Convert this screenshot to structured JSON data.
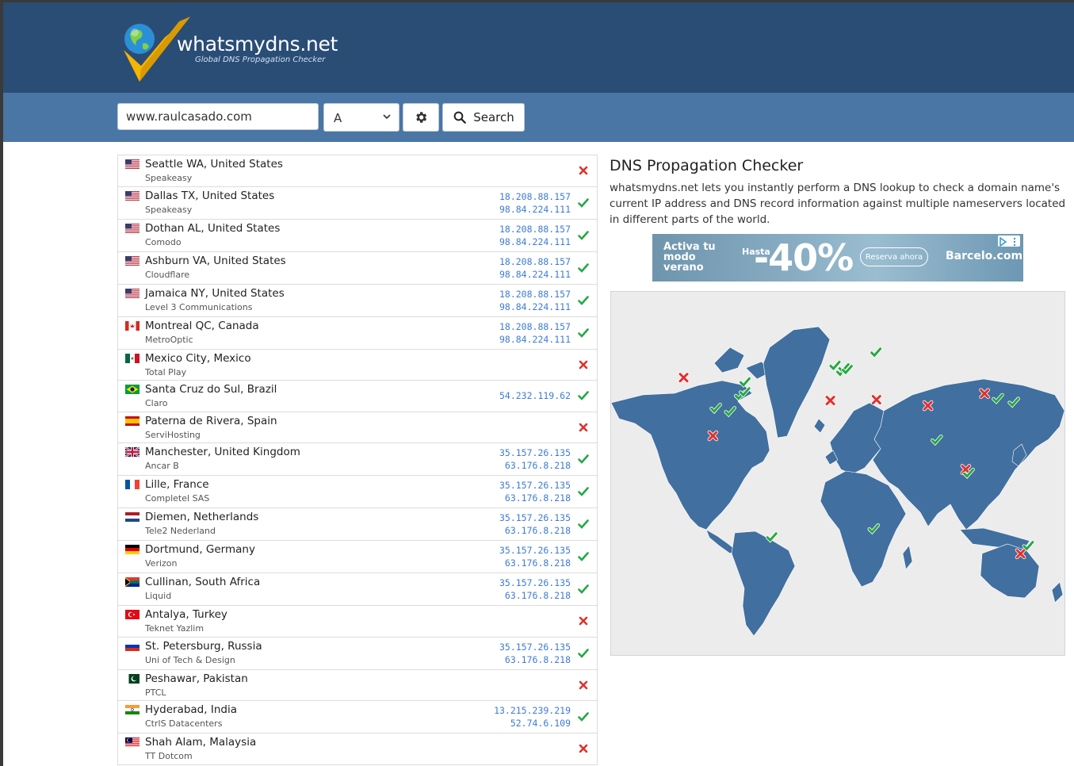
{
  "header": {
    "brand": "whatsmydns.net",
    "tagline": "Global DNS Propagation Checker"
  },
  "search": {
    "domain_value": "www.raulcasado.com",
    "record_type": "A",
    "search_label": "Search"
  },
  "colors": {
    "header_bg": "#2a4d76",
    "searchbar_bg": "#4a76a6",
    "ok": "#27a844",
    "fail": "#e0312e",
    "ip": "#3e7bd6",
    "map_land": "#416f9f"
  },
  "results": [
    {
      "location": "Seattle WA, United States",
      "provider": "Speakeasy",
      "flag": "us",
      "ips": [],
      "status": "fail"
    },
    {
      "location": "Dallas TX, United States",
      "provider": "Speakeasy",
      "flag": "us",
      "ips": [
        "18.208.88.157",
        "98.84.224.111"
      ],
      "status": "ok"
    },
    {
      "location": "Dothan AL, United States",
      "provider": "Comodo",
      "flag": "us",
      "ips": [
        "18.208.88.157",
        "98.84.224.111"
      ],
      "status": "ok"
    },
    {
      "location": "Ashburn VA, United States",
      "provider": "Cloudflare",
      "flag": "us",
      "ips": [
        "18.208.88.157",
        "98.84.224.111"
      ],
      "status": "ok"
    },
    {
      "location": "Jamaica NY, United States",
      "provider": "Level 3 Communications",
      "flag": "us",
      "ips": [
        "18.208.88.157",
        "98.84.224.111"
      ],
      "status": "ok"
    },
    {
      "location": "Montreal QC, Canada",
      "provider": "MetroOptic",
      "flag": "ca",
      "ips": [
        "18.208.88.157",
        "98.84.224.111"
      ],
      "status": "ok"
    },
    {
      "location": "Mexico City, Mexico",
      "provider": "Total Play",
      "flag": "mx",
      "ips": [],
      "status": "fail"
    },
    {
      "location": "Santa Cruz do Sul, Brazil",
      "provider": "Claro",
      "flag": "br",
      "ips": [
        "54.232.119.62"
      ],
      "status": "ok"
    },
    {
      "location": "Paterna de Rivera, Spain",
      "provider": "ServiHosting",
      "flag": "es",
      "ips": [],
      "status": "fail"
    },
    {
      "location": "Manchester, United Kingdom",
      "provider": "Ancar B",
      "flag": "gb",
      "ips": [
        "35.157.26.135",
        "63.176.8.218"
      ],
      "status": "ok"
    },
    {
      "location": "Lille, France",
      "provider": "Completel SAS",
      "flag": "fr",
      "ips": [
        "35.157.26.135",
        "63.176.8.218"
      ],
      "status": "ok"
    },
    {
      "location": "Diemen, Netherlands",
      "provider": "Tele2 Nederland",
      "flag": "nl",
      "ips": [
        "35.157.26.135",
        "63.176.8.218"
      ],
      "status": "ok"
    },
    {
      "location": "Dortmund, Germany",
      "provider": "Verizon",
      "flag": "de",
      "ips": [
        "35.157.26.135",
        "63.176.8.218"
      ],
      "status": "ok"
    },
    {
      "location": "Cullinan, South Africa",
      "provider": "Liquid",
      "flag": "za",
      "ips": [
        "35.157.26.135",
        "63.176.8.218"
      ],
      "status": "ok"
    },
    {
      "location": "Antalya, Turkey",
      "provider": "Teknet Yazlim",
      "flag": "tr",
      "ips": [],
      "status": "fail"
    },
    {
      "location": "St. Petersburg, Russia",
      "provider": "Uni of Tech & Design",
      "flag": "ru",
      "ips": [
        "35.157.26.135",
        "63.176.8.218"
      ],
      "status": "ok"
    },
    {
      "location": "Peshawar, Pakistan",
      "provider": "PTCL",
      "flag": "pk",
      "ips": [],
      "status": "fail"
    },
    {
      "location": "Hyderabad, India",
      "provider": "CtrlS Datacenters",
      "flag": "in",
      "ips": [
        "13.215.239.219",
        "52.74.6.109"
      ],
      "status": "ok"
    },
    {
      "location": "Shah Alam, Malaysia",
      "provider": "TT Dotcom",
      "flag": "my",
      "ips": [],
      "status": "fail"
    }
  ],
  "sidebar": {
    "title": "DNS Propagation Checker",
    "description": "whatsmydns.net lets you instantly perform a DNS lookup to check a domain name's current IP address and DNS record information against multiple nameservers located in different parts of the world."
  },
  "ad": {
    "line1": "Activa tu modo verano",
    "prefix": "Hasta",
    "discount": "-40%",
    "cta": "Reserva ahora",
    "brand": "Barcelo.com"
  },
  "map": {
    "markers": [
      {
        "label": "Seattle WA",
        "status": "fail",
        "lat": 47.6,
        "lon": -122.3
      },
      {
        "label": "Dallas TX",
        "status": "ok",
        "lat": 32.8,
        "lon": -96.8
      },
      {
        "label": "Dothan AL",
        "status": "ok",
        "lat": 31.2,
        "lon": -85.4
      },
      {
        "label": "Ashburn VA",
        "status": "ok",
        "lat": 39.0,
        "lon": -77.5
      },
      {
        "label": "Jamaica NY",
        "status": "ok",
        "lat": 40.7,
        "lon": -73.8
      },
      {
        "label": "Montreal QC",
        "status": "ok",
        "lat": 45.5,
        "lon": -73.6
      },
      {
        "label": "Mexico City",
        "status": "fail",
        "lat": 19.4,
        "lon": -99.1
      },
      {
        "label": "Santa Cruz do Sul",
        "status": "ok",
        "lat": -29.7,
        "lon": -52.4
      },
      {
        "label": "Paterna de Rivera",
        "status": "fail",
        "lat": 36.5,
        "lon": -5.9
      },
      {
        "label": "Manchester",
        "status": "ok",
        "lat": 53.5,
        "lon": -2.2
      },
      {
        "label": "Lille",
        "status": "ok",
        "lat": 50.6,
        "lon": 3.1
      },
      {
        "label": "Diemen",
        "status": "ok",
        "lat": 52.3,
        "lon": 4.9
      },
      {
        "label": "Dortmund",
        "status": "ok",
        "lat": 51.5,
        "lon": 7.5
      },
      {
        "label": "Cullinan",
        "status": "ok",
        "lat": -25.7,
        "lon": 28.5
      },
      {
        "label": "Antalya",
        "status": "fail",
        "lat": 36.9,
        "lon": 30.7
      },
      {
        "label": "St. Petersburg",
        "status": "ok",
        "lat": 59.9,
        "lon": 30.3
      },
      {
        "label": "Peshawar",
        "status": "fail",
        "lat": 34.0,
        "lon": 71.5
      },
      {
        "label": "Hyderabad",
        "status": "ok",
        "lat": 17.4,
        "lon": 78.5
      },
      {
        "label": "Shah Alam",
        "status": "fail",
        "lat": 3.1,
        "lon": 101.5
      },
      {
        "label": "Singapore",
        "status": "ok",
        "lat": 1.3,
        "lon": 103.8
      },
      {
        "label": "Beijing",
        "status": "fail",
        "lat": 39.9,
        "lon": 116.4
      },
      {
        "label": "Seoul",
        "status": "ok",
        "lat": 37.5,
        "lon": 127.0
      },
      {
        "label": "Tokyo",
        "status": "ok",
        "lat": 35.7,
        "lon": 139.7
      },
      {
        "label": "Melbourne",
        "status": "fail",
        "lat": -37.8,
        "lon": 145.0
      },
      {
        "label": "Sydney",
        "status": "ok",
        "lat": -33.9,
        "lon": 151.2
      }
    ]
  }
}
